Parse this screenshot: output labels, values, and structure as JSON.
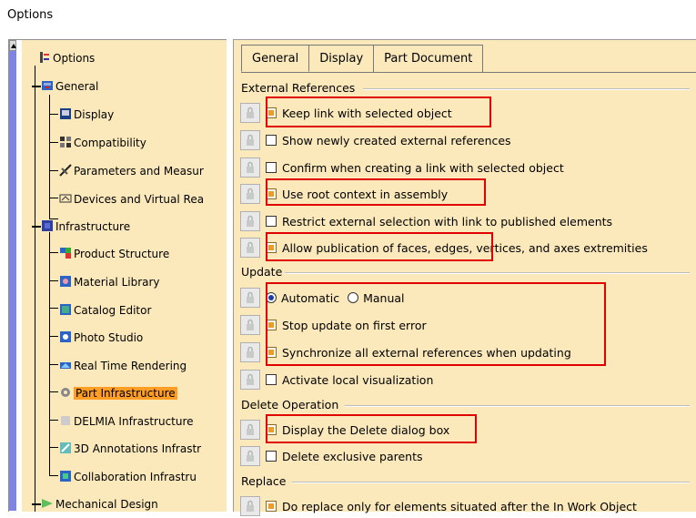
{
  "window": {
    "title": "Options"
  },
  "colors": {
    "tree_bg": "#fbe9bc",
    "selected": "#ff9d25",
    "highlight": "#e00000",
    "scroll_accent": "#7f84e2"
  },
  "tree": {
    "root": "Options",
    "items": [
      {
        "label": "General",
        "icon": "general-icon"
      },
      {
        "label": "Display",
        "icon": "display-icon"
      },
      {
        "label": "Compatibility",
        "icon": "compatibility-icon"
      },
      {
        "label": "Parameters and Measur",
        "icon": "parameters-icon"
      },
      {
        "label": "Devices and Virtual Rea",
        "icon": "devices-icon"
      },
      {
        "label": "Infrastructure",
        "icon": "infrastructure-icon"
      },
      {
        "label": "Product Structure",
        "icon": "product-structure-icon"
      },
      {
        "label": "Material Library",
        "icon": "material-library-icon"
      },
      {
        "label": "Catalog Editor",
        "icon": "catalog-editor-icon"
      },
      {
        "label": "Photo Studio",
        "icon": "photo-studio-icon"
      },
      {
        "label": "Real Time Rendering",
        "icon": "real-time-rendering-icon"
      },
      {
        "label": "Part Infrastructure",
        "icon": "part-infrastructure-icon",
        "selected": true
      },
      {
        "label": "DELMIA Infrastructure",
        "icon": "delmia-icon"
      },
      {
        "label": "3D Annotations Infrastr",
        "icon": "annotations-icon"
      },
      {
        "label": "Collaboration Infrastru",
        "icon": "collaboration-icon"
      },
      {
        "label": "Mechanical Design",
        "icon": "mechanical-design-icon"
      }
    ]
  },
  "tabs": [
    {
      "label": "General",
      "active": true
    },
    {
      "label": "Display",
      "active": false
    },
    {
      "label": "Part Document",
      "active": false
    }
  ],
  "sections": {
    "external_references": {
      "title": "External References",
      "options": [
        {
          "label": "Keep link with selected object",
          "checked": true,
          "highlighted": true
        },
        {
          "label": "Show newly created external references",
          "checked": false
        },
        {
          "label": "Confirm when creating a link with selected object",
          "checked": false
        },
        {
          "label": "Use root context in assembly",
          "checked": true,
          "highlighted": true
        },
        {
          "label": "Restrict external selection with link to published elements",
          "checked": false
        },
        {
          "label": "Allow publication of faces, edges, vertices, and axes extremities",
          "checked": true,
          "highlighted": true
        }
      ]
    },
    "update": {
      "title": "Update",
      "radio_automatic": "Automatic",
      "radio_manual": "Manual",
      "selected_mode": "Automatic",
      "options": [
        {
          "label": "Stop update on first error",
          "checked": true
        },
        {
          "label": "Synchronize all external references when updating",
          "checked": true
        },
        {
          "label": "Activate local visualization",
          "checked": false
        }
      ]
    },
    "delete_operation": {
      "title": "Delete Operation",
      "options": [
        {
          "label": "Display the Delete dialog box",
          "checked": true,
          "highlighted": true
        },
        {
          "label": "Delete exclusive parents",
          "checked": false
        }
      ]
    },
    "replace": {
      "title": "Replace",
      "options": [
        {
          "label": "Do replace only for elements situated after the In Work Object",
          "checked": true
        }
      ]
    }
  }
}
